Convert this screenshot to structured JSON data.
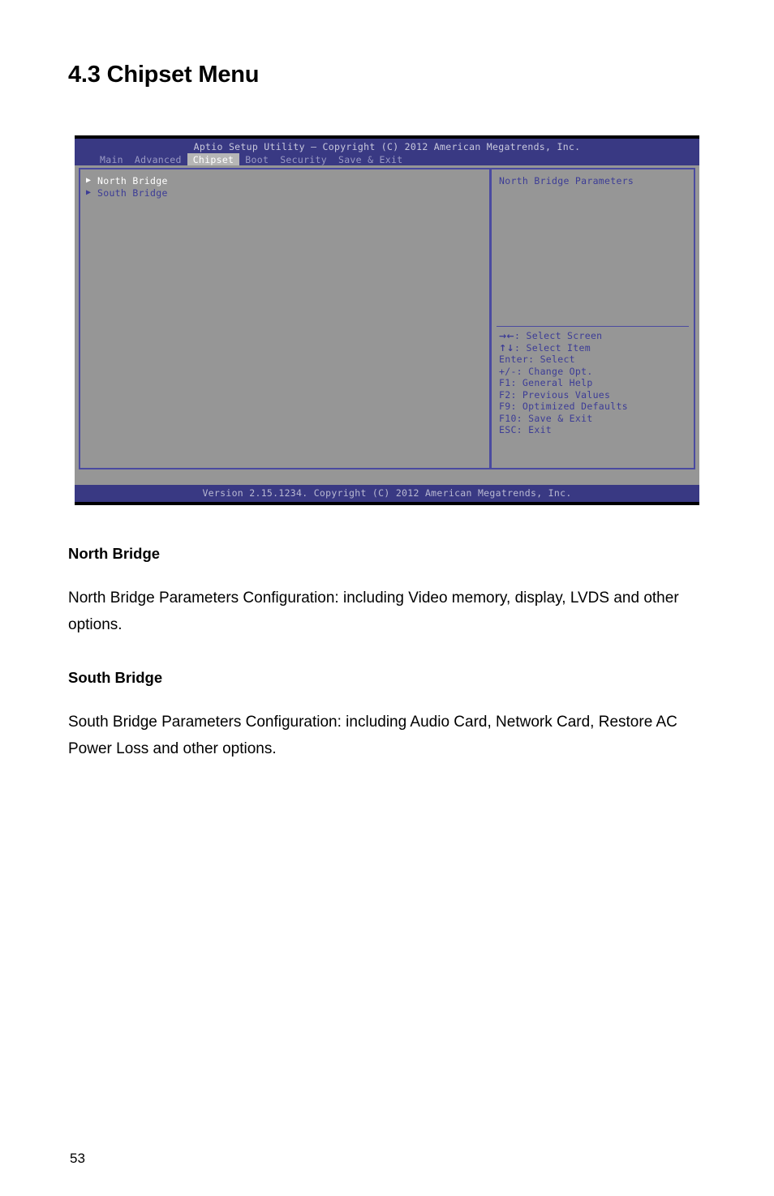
{
  "document": {
    "section_title": "4.3 Chipset Menu",
    "page_number": "53",
    "sections": [
      {
        "heading": "North Bridge",
        "body": "North Bridge Parameters Configuration: including Video memory, display, LVDS and other options."
      },
      {
        "heading": "South Bridge",
        "body": "South Bridge Parameters Configuration: including Audio Card, Network Card, Restore AC Power Loss and other options."
      }
    ]
  },
  "bios": {
    "title": "Aptio Setup Utility – Copyright (C) 2012 American Megatrends, Inc.",
    "tabs": [
      {
        "label": "Main",
        "selected": false
      },
      {
        "label": "Advanced",
        "selected": false
      },
      {
        "label": "Chipset",
        "selected": true
      },
      {
        "label": "Boot",
        "selected": false
      },
      {
        "label": "Security",
        "selected": false
      },
      {
        "label": "Save & Exit",
        "selected": false
      }
    ],
    "menu_items": [
      {
        "arrow": "▶",
        "label": "North Bridge",
        "selected": true
      },
      {
        "arrow": "▶",
        "label": "South Bridge",
        "selected": false
      }
    ],
    "help": {
      "title": "North Bridge Parameters",
      "keys": [
        {
          "glyph": "→←",
          "text": ": Select Screen"
        },
        {
          "glyph": "↑↓",
          "text": ": Select Item"
        },
        {
          "glyph": "",
          "text": "Enter: Select"
        },
        {
          "glyph": "",
          "text": "+/-: Change Opt."
        },
        {
          "glyph": "",
          "text": "F1: General Help"
        },
        {
          "glyph": "",
          "text": "F2: Previous Values"
        },
        {
          "glyph": "",
          "text": "F9: Optimized Defaults"
        },
        {
          "glyph": "",
          "text": "F10: Save & Exit"
        },
        {
          "glyph": "",
          "text": "ESC: Exit"
        }
      ]
    },
    "version": "Version 2.15.1234. Copyright (C) 2012 American Megatrends, Inc.",
    "colors": {
      "header_bg": "#393983",
      "body_bg": "#969696",
      "panel_border": "#4a4aa0",
      "text_blue": "#3c3c96",
      "tab_selected_bg": "#b6b6b6"
    }
  }
}
